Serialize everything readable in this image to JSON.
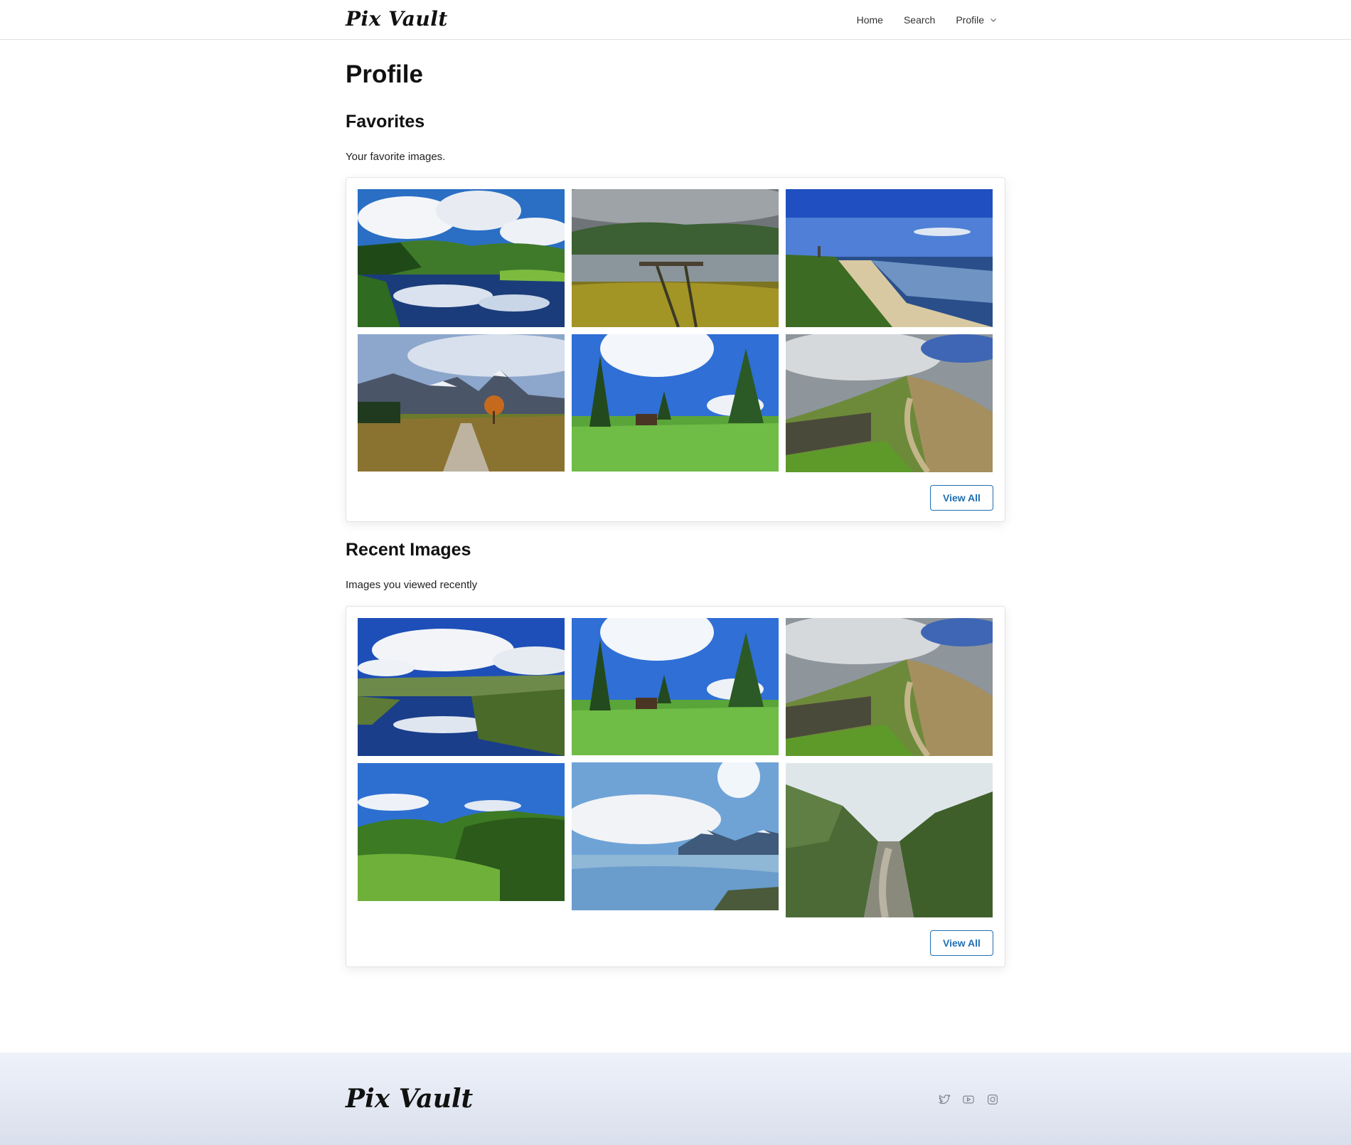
{
  "header": {
    "brand": "Pix Vault",
    "nav": {
      "home": "Home",
      "search": "Search",
      "profile": "Profile"
    }
  },
  "page": {
    "title": "Profile"
  },
  "favorites": {
    "title": "Favorites",
    "description": "Your favorite images.",
    "button": "View All",
    "images": [
      "lake reflection with hills",
      "lakeshore pier under clouds",
      "coastal beach with church",
      "mountain path with autumn tree",
      "meadow with barn and pines",
      "hill path with stone wall"
    ]
  },
  "recent": {
    "title": "Recent Images",
    "description": "Images you viewed recently",
    "button": "View All",
    "images": [
      "marsh pond reflecting clouds",
      "meadow with barn and pines",
      "hill path with stone wall",
      "green valley with hills",
      "glacier under bright sky",
      "river gorge with terraces"
    ]
  },
  "footer": {
    "brand": "Pix Vault",
    "social": [
      "twitter-icon",
      "youtube-icon",
      "instagram-icon"
    ]
  },
  "colors": {
    "accent": "#1f6fb2",
    "footer_top": "#eef2fa",
    "footer_bottom": "#d9dfec"
  }
}
